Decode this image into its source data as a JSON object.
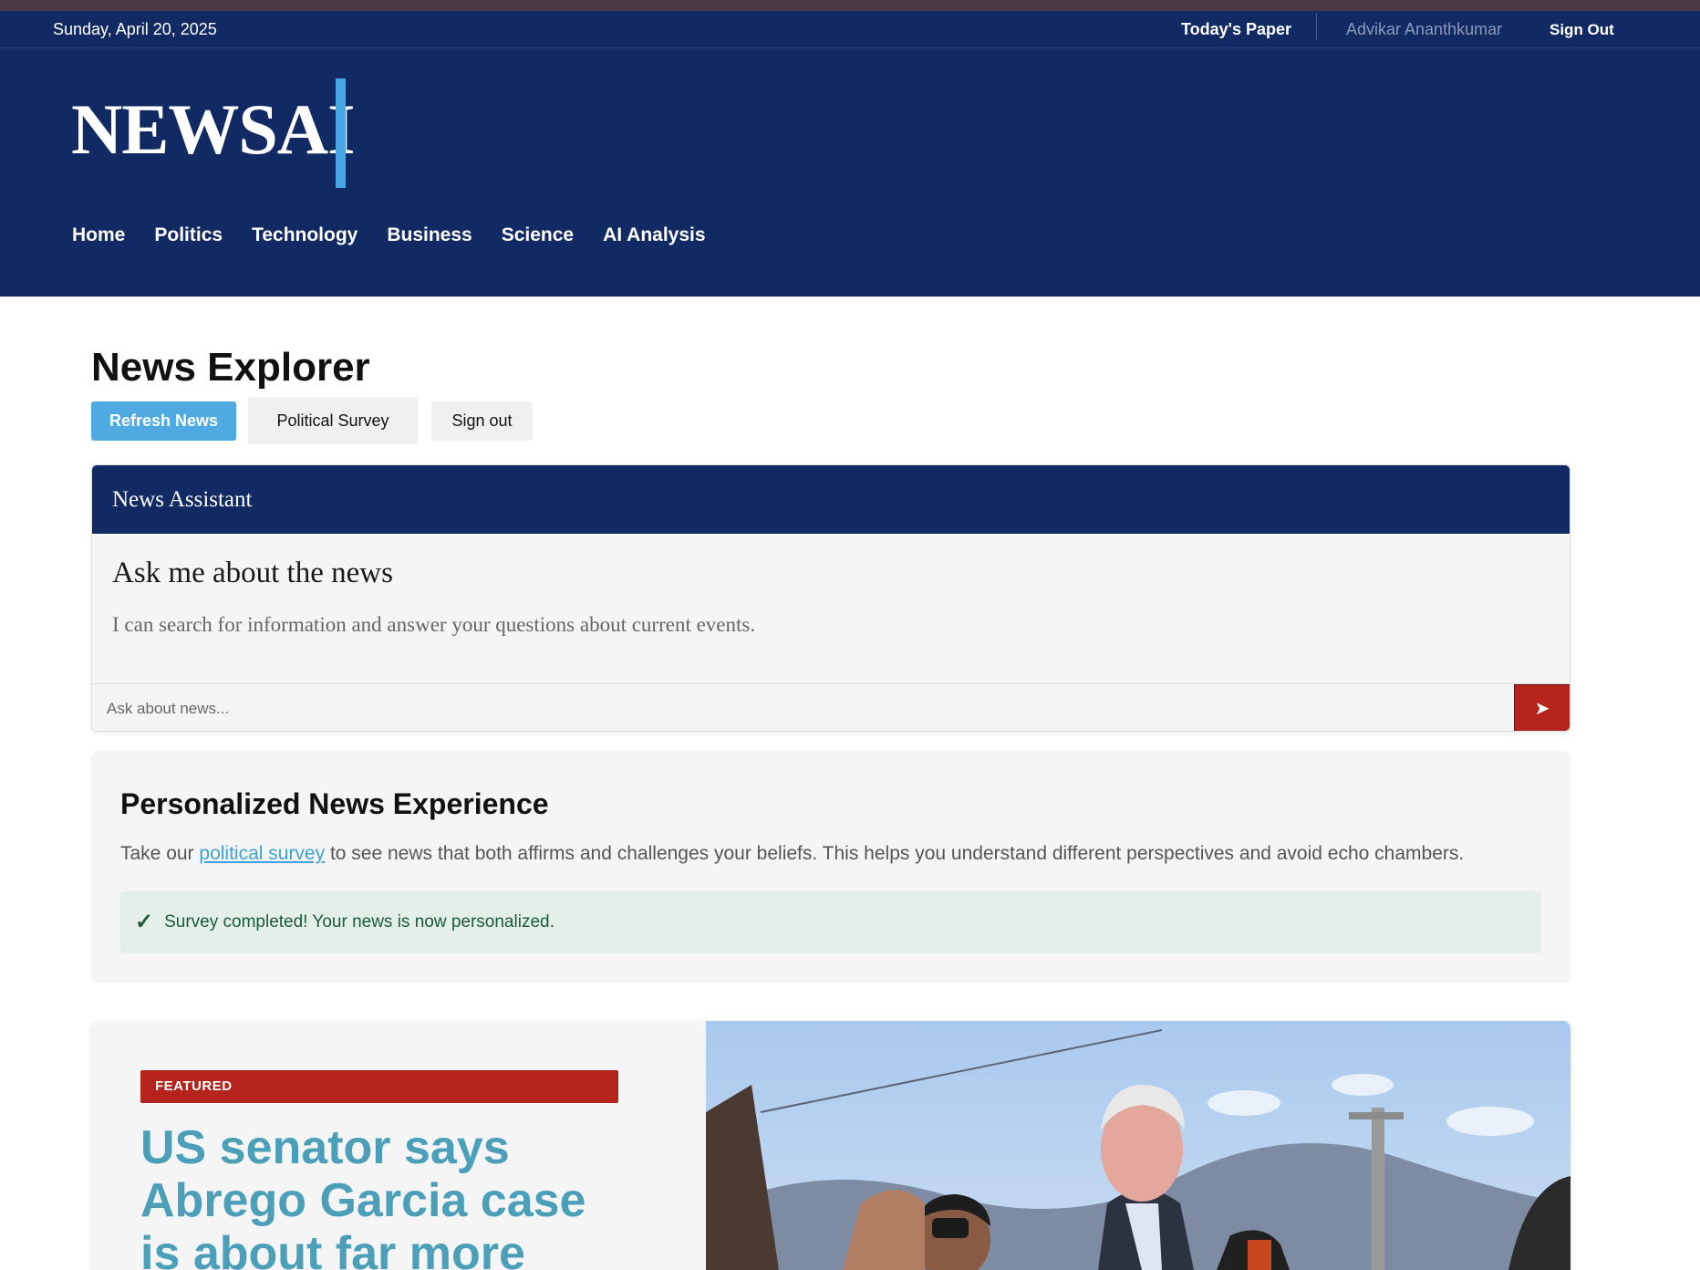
{
  "topbar": {
    "date": "Sunday, April 20, 2025",
    "todays_paper": "Today's Paper",
    "user_name": "Advikar Ananthkumar",
    "sign_out": "Sign Out"
  },
  "header": {
    "logo": "NEWSAI",
    "nav": [
      "Home",
      "Politics",
      "Technology",
      "Business",
      "Science",
      "AI Analysis"
    ]
  },
  "explorer": {
    "title": "News Explorer",
    "refresh_label": "Refresh News",
    "survey_label": "Political Survey",
    "signout_label": "Sign out"
  },
  "assistant": {
    "header": "News Assistant",
    "question": "Ask me about the news",
    "description": "I can search for information and answer your questions about current events.",
    "input_placeholder": "Ask about news...",
    "send_icon": "send-arrow-icon"
  },
  "personalized": {
    "title": "Personalized News Experience",
    "text_before": "Take our ",
    "link": "political survey",
    "text_after": " to see news that both affirms and challenges your beliefs. This helps you understand different perspectives and avoid echo chambers.",
    "status": "Survey completed! Your news is now personalized."
  },
  "featured": {
    "badge": "FEATURED",
    "title": "US senator says Abrego Garcia case is about far more than"
  },
  "colors": {
    "navy": "#112a63",
    "accent_blue": "#4aa5e3",
    "featured_red": "#b5241c",
    "headline_teal": "#4b9fb8",
    "success_green": "#1d5b3a"
  }
}
